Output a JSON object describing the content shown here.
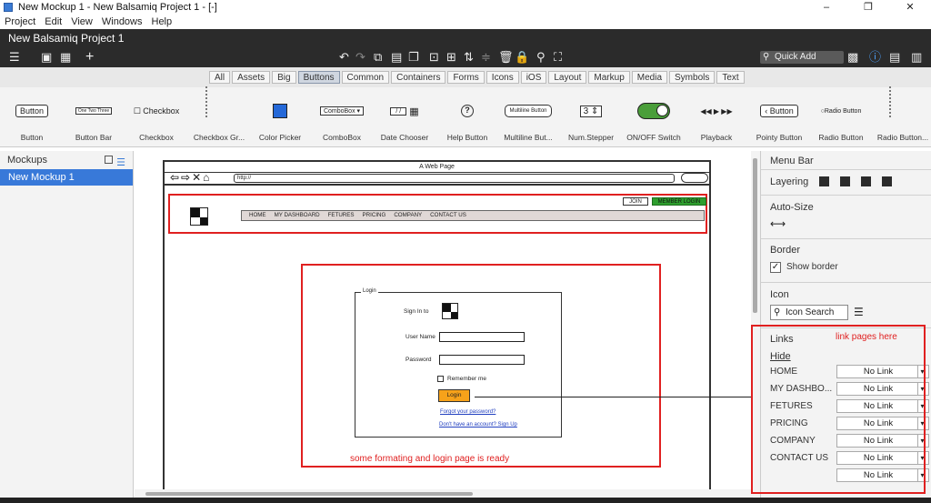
{
  "window": {
    "title": "New Mockup 1 - New Balsamiq Project 1 - [-]",
    "controls": [
      "–",
      "❐",
      "✕"
    ]
  },
  "menubar": {
    "items": [
      "Project",
      "Edit",
      "View",
      "Windows",
      "Help"
    ]
  },
  "project": {
    "name": "New Balsamiq Project 1"
  },
  "toolbar": {
    "quick_add_placeholder": "Quick Add",
    "icons": [
      "menu-icon",
      "single-pane-icon",
      "grid-icon",
      "add-icon",
      "undo-icon",
      "redo-icon",
      "copy-icon",
      "paste-icon",
      "duplicate-icon",
      "delete-icon",
      "group-icon",
      "ungroup-icon",
      "lock-icon",
      "search-icon",
      "fullscreen-icon",
      "info-icon",
      "notes-icon"
    ]
  },
  "filter_tabs": {
    "active": "Buttons",
    "items": [
      "All",
      "Assets",
      "Big",
      "Buttons",
      "Common",
      "Containers",
      "Forms",
      "Icons",
      "iOS",
      "Layout",
      "Markup",
      "Media",
      "Symbols",
      "Text"
    ]
  },
  "components": [
    {
      "label": "Button",
      "preview": "Button"
    },
    {
      "label": "Button Bar",
      "preview": "One Two Three"
    },
    {
      "label": "Checkbox",
      "preview": "Checkbox"
    },
    {
      "label": "Checkbox Gr...",
      "preview": ""
    },
    {
      "label": "Color Picker",
      "preview": ""
    },
    {
      "label": "ComboBox",
      "preview": "ComboBox"
    },
    {
      "label": "Date Chooser",
      "preview": "/ /"
    },
    {
      "label": "Help Button",
      "preview": "?"
    },
    {
      "label": "Multiline But...",
      "preview": "Multiline Button"
    },
    {
      "label": "Num.Stepper",
      "preview": "3"
    },
    {
      "label": "ON/OFF Switch",
      "preview": ""
    },
    {
      "label": "Playback",
      "preview": "◀◀ ▶ ▶▶"
    },
    {
      "label": "Pointy Button",
      "preview": "‹ Button"
    },
    {
      "label": "Radio Button",
      "preview": "Radio Button"
    },
    {
      "label": "Radio Button...",
      "preview": ""
    }
  ],
  "mockups_panel": {
    "title": "Mockups",
    "items": [
      "New Mockup 1"
    ]
  },
  "mockup": {
    "page_title": "A Web Page",
    "url": "http://",
    "nav_items": [
      "HOME",
      "MY DASHBOARD",
      "FETURES",
      "PRICING",
      "COMPANY",
      "CONTACT US"
    ],
    "join": "JOIN",
    "member_login": "MEMBER LOGIN",
    "login": {
      "legend": "Login",
      "sign_in_to": "Sign In to",
      "user_name": "User Name",
      "password": "Password",
      "remember": "Remember me",
      "button": "Login",
      "forgot": "Forgot your password?",
      "signup": "Don't have an account? Sign Up"
    },
    "annotation_login": "some formating and login page is ready"
  },
  "inspector": {
    "title": "Menu Bar",
    "layering": "Layering",
    "auto_size": "Auto-Size",
    "border": "Border",
    "show_border": "Show border",
    "icon": "Icon",
    "icon_search_placeholder": "Icon Search",
    "links": "Links",
    "annotation_links": "link pages here",
    "hide": "Hide",
    "link_rows": [
      {
        "label": "HOME",
        "value": "No Link"
      },
      {
        "label": "MY DASHBO...",
        "value": "No Link"
      },
      {
        "label": "FETURES",
        "value": "No Link"
      },
      {
        "label": "PRICING",
        "value": "No Link"
      },
      {
        "label": "COMPANY",
        "value": "No Link"
      },
      {
        "label": "CONTACT US",
        "value": "No Link"
      },
      {
        "label": "",
        "value": "No Link"
      }
    ]
  },
  "colors": {
    "accent": "#3879d9",
    "annotation_red": "#e02020",
    "dark_bar": "#2b2b2b",
    "login_orange": "#f7a21a",
    "member_green": "#2e9e2e"
  }
}
